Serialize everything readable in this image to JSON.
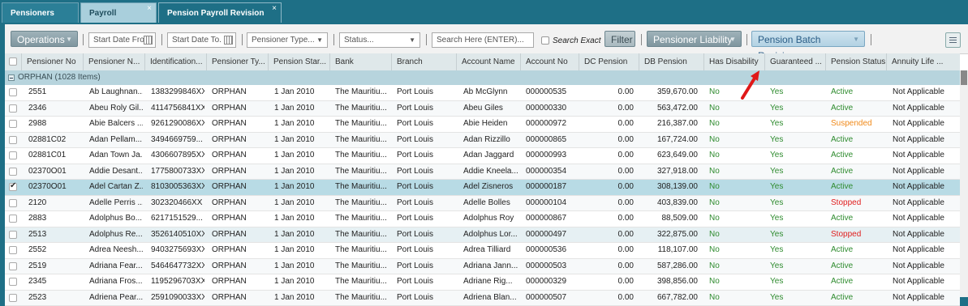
{
  "tabs": [
    {
      "label": "Pensioners Links"
    },
    {
      "label": "Payroll Register",
      "close": "×"
    },
    {
      "label": "Pension Payroll Revision Batch",
      "close": "×"
    }
  ],
  "toolbar": {
    "operations": "Operations",
    "start_date_from": "Start Date Fro",
    "start_date_to": "Start Date To.",
    "pensioner_type": "Pensioner Type...",
    "status": "Status...",
    "search_placeholder": "Search Here (ENTER)...",
    "search_exact": "Search Exact",
    "filter": "Filter",
    "pensioner_liability": "Pensioner Liability",
    "pension_batch_revisions": "Pension Batch Revisions"
  },
  "columns": [
    "Pensioner No",
    "Pensioner N...",
    "Identification...",
    "Pensioner Ty...",
    "Pension Star...",
    "Bank",
    "Branch",
    "Account Name",
    "Account No",
    "DC Pension",
    "DB Pension",
    "Has Disability",
    "Guaranteed ...",
    "Pension Status",
    "Annuity Life ..."
  ],
  "group": {
    "label": "ORPHAN (1028 Items)"
  },
  "rows": [
    {
      "no": "2551",
      "name": "Ab Laughnan...",
      "id": "1383299846XX",
      "type": "ORPHAN",
      "start": "1 Jan 2010",
      "bank": "The Mauritiu...",
      "branch": "Port Louis",
      "acct_name": "Ab McGlynn",
      "acct_no": "000000535",
      "dc": "0.00",
      "db": "359,670.00",
      "dis": "No",
      "guar": "Yes",
      "status": "Active",
      "annuity": "Not Applicable"
    },
    {
      "no": "2346",
      "name": "Abeu Roly Gil...",
      "id": "4114756841XX",
      "type": "ORPHAN",
      "start": "1 Jan 2010",
      "bank": "The Mauritiu...",
      "branch": "Port Louis",
      "acct_name": "Abeu Giles",
      "acct_no": "000000330",
      "dc": "0.00",
      "db": "563,472.00",
      "dis": "No",
      "guar": "Yes",
      "status": "Active",
      "annuity": "Not Applicable"
    },
    {
      "no": "2988",
      "name": "Abie Balcers ...",
      "id": "9261290086XX",
      "type": "ORPHAN",
      "start": "1 Jan 2010",
      "bank": "The Mauritiu...",
      "branch": "Port Louis",
      "acct_name": "Abie Heiden",
      "acct_no": "000000972",
      "dc": "0.00",
      "db": "216,387.00",
      "dis": "No",
      "guar": "Yes",
      "status": "Suspended",
      "annuity": "Not Applicable"
    },
    {
      "no": "02881C02",
      "name": "Adan Pellam...",
      "id": "3494669759...",
      "type": "ORPHAN",
      "start": "1 Jan 2010",
      "bank": "The Mauritiu...",
      "branch": "Port Louis",
      "acct_name": "Adan Rizzillo",
      "acct_no": "000000865",
      "dc": "0.00",
      "db": "167,724.00",
      "dis": "No",
      "guar": "Yes",
      "status": "Active",
      "annuity": "Not Applicable"
    },
    {
      "no": "02881C01",
      "name": "Adan Town Ja...",
      "id": "4306607895XX",
      "type": "ORPHAN",
      "start": "1 Jan 2010",
      "bank": "The Mauritiu...",
      "branch": "Port Louis",
      "acct_name": "Adan Jaggard",
      "acct_no": "000000993",
      "dc": "0.00",
      "db": "623,649.00",
      "dis": "No",
      "guar": "Yes",
      "status": "Active",
      "annuity": "Not Applicable"
    },
    {
      "no": "02370O01",
      "name": "Addie Desant...",
      "id": "1775800733XX",
      "type": "ORPHAN",
      "start": "1 Jan 2010",
      "bank": "The Mauritiu...",
      "branch": "Port Louis",
      "acct_name": "Addie Kneela...",
      "acct_no": "000000354",
      "dc": "0.00",
      "db": "327,918.00",
      "dis": "No",
      "guar": "Yes",
      "status": "Active",
      "annuity": "Not Applicable"
    },
    {
      "no": "02370O01",
      "name": "Adel Cartan Z...",
      "id": "8103005363XX",
      "type": "ORPHAN",
      "start": "1 Jan 2010",
      "bank": "The Mauritiu...",
      "branch": "Port Louis",
      "acct_name": "Adel Zisneros",
      "acct_no": "000000187",
      "dc": "0.00",
      "db": "308,139.00",
      "dis": "No",
      "guar": "Yes",
      "status": "Active",
      "annuity": "Not Applicable",
      "selected": true
    },
    {
      "no": "2120",
      "name": "Adelle Perris ...",
      "id": "302320466XX",
      "type": "ORPHAN",
      "start": "1 Jan 2010",
      "bank": "The Mauritiu...",
      "branch": "Port Louis",
      "acct_name": "Adelle Bolles",
      "acct_no": "000000104",
      "dc": "0.00",
      "db": "403,839.00",
      "dis": "No",
      "guar": "Yes",
      "status": "Stopped",
      "annuity": "Not Applicable"
    },
    {
      "no": "2883",
      "name": "Adolphus Bo...",
      "id": "6217151529...",
      "type": "ORPHAN",
      "start": "1 Jan 2010",
      "bank": "The Mauritiu...",
      "branch": "Port Louis",
      "acct_name": "Adolphus Roy",
      "acct_no": "000000867",
      "dc": "0.00",
      "db": "88,509.00",
      "dis": "No",
      "guar": "Yes",
      "status": "Active",
      "annuity": "Not Applicable"
    },
    {
      "no": "2513",
      "name": "Adolphus Re...",
      "id": "3526140510XX",
      "type": "ORPHAN",
      "start": "1 Jan 2010",
      "bank": "The Mauritiu...",
      "branch": "Port Louis",
      "acct_name": "Adolphus Lor...",
      "acct_no": "000000497",
      "dc": "0.00",
      "db": "322,875.00",
      "dis": "No",
      "guar": "Yes",
      "status": "Stopped",
      "annuity": "Not Applicable",
      "hover": true
    },
    {
      "no": "2552",
      "name": "Adrea Neesh...",
      "id": "9403275693XX",
      "type": "ORPHAN",
      "start": "1 Jan 2010",
      "bank": "The Mauritiu...",
      "branch": "Port Louis",
      "acct_name": "Adrea Tilliard",
      "acct_no": "000000536",
      "dc": "0.00",
      "db": "118,107.00",
      "dis": "No",
      "guar": "Yes",
      "status": "Active",
      "annuity": "Not Applicable"
    },
    {
      "no": "2519",
      "name": "Adriana Fear...",
      "id": "5464647732XX",
      "type": "ORPHAN",
      "start": "1 Jan 2010",
      "bank": "The Mauritiu...",
      "branch": "Port Louis",
      "acct_name": "Adriana Jann...",
      "acct_no": "000000503",
      "dc": "0.00",
      "db": "587,286.00",
      "dis": "No",
      "guar": "Yes",
      "status": "Active",
      "annuity": "Not Applicable"
    },
    {
      "no": "2345",
      "name": "Adriana Fros...",
      "id": "1195296703XX",
      "type": "ORPHAN",
      "start": "1 Jan 2010",
      "bank": "The Mauritiu...",
      "branch": "Port Louis",
      "acct_name": "Adriane Rig...",
      "acct_no": "000000329",
      "dc": "0.00",
      "db": "398,856.00",
      "dis": "No",
      "guar": "Yes",
      "status": "Active",
      "annuity": "Not Applicable"
    },
    {
      "no": "2523",
      "name": "Adriena Pear...",
      "id": "2591090033XX",
      "type": "ORPHAN",
      "start": "1 Jan 2010",
      "bank": "The Mauritiu...",
      "branch": "Port Louis",
      "acct_name": "Adriena Blan...",
      "acct_no": "000000507",
      "dc": "0.00",
      "db": "667,782.00",
      "dis": "No",
      "guar": "Yes",
      "status": "Active",
      "annuity": "Not Applicable"
    }
  ],
  "colors": {
    "active": "#2e8b2e",
    "suspended": "#f08a1a",
    "stopped": "#e02020",
    "accent": "#1e6f86"
  }
}
